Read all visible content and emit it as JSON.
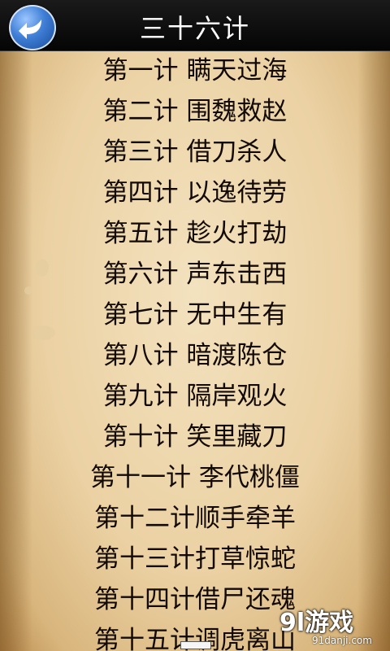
{
  "header": {
    "title": "三十六计",
    "back_icon": "back-arrow-icon"
  },
  "strategies": [
    "第一计 瞒天过海",
    "第二计 围魏救赵",
    "第三计 借刀杀人",
    "第四计 以逸待劳",
    "第五计 趁火打劫",
    "第六计 声东击西",
    "第七计 无中生有",
    "第八计 暗渡陈仓",
    "第九计 隔岸观火",
    "第十计 笑里藏刀",
    "第十一计 李代桃僵",
    "第十二计顺手牵羊",
    "第十三计打草惊蛇",
    "第十四计借尸还魂",
    "第十五计调虎离山"
  ],
  "watermark": {
    "logo": "9l游戏",
    "url": "91danji.com"
  },
  "colors": {
    "titlebar": "#0a0a0a",
    "parchment": "#ecd3a6",
    "text": "#120a02",
    "back_button": "#3f7fd6"
  }
}
